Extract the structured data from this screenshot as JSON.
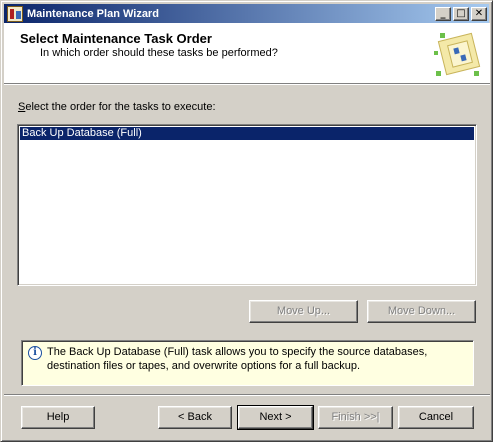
{
  "window": {
    "title": "Maintenance Plan Wizard",
    "minimize_glyph": "_",
    "maximize_glyph": "□",
    "close_glyph": "✕"
  },
  "header": {
    "title": "Select Maintenance Task Order",
    "subtitle": "In which order should these tasks be performed?"
  },
  "task_list": {
    "label": "Select the order for the tasks to execute:",
    "items": [
      {
        "label": "Back Up Database (Full)",
        "selected": true
      }
    ]
  },
  "order_buttons": {
    "move_up": "Move Up...",
    "move_down": "Move Down..."
  },
  "info": {
    "icon": "info-icon",
    "text": "The Back Up Database (Full) task allows you to specify the source databases, destination files or tapes, and overwrite options for a full backup."
  },
  "footer": {
    "help": "Help",
    "back": "< Back",
    "next": "Next >",
    "finish": "Finish >>|",
    "cancel": "Cancel"
  },
  "colors": {
    "titlebar_start": "#0a246a",
    "titlebar_end": "#a6caf0",
    "selection": "#0a246a",
    "info_background": "#ffffe1",
    "dialog_face": "#d4d0c8"
  }
}
